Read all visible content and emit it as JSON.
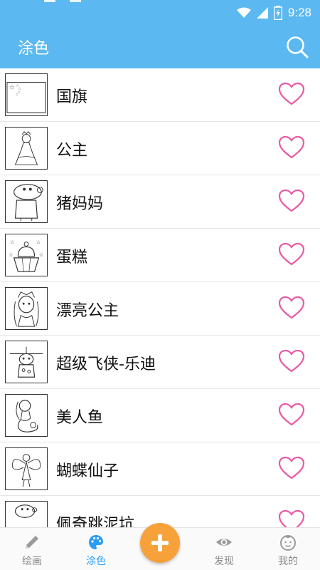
{
  "status": {
    "time": "9:28"
  },
  "header": {
    "title": "涂色"
  },
  "items": [
    {
      "label": "国旗"
    },
    {
      "label": "公主"
    },
    {
      "label": "猪妈妈"
    },
    {
      "label": "蛋糕"
    },
    {
      "label": "漂亮公主"
    },
    {
      "label": "超级飞侠-乐迪"
    },
    {
      "label": "美人鱼"
    },
    {
      "label": "蝴蝶仙子"
    },
    {
      "label": "佩奇跳泥坑"
    }
  ],
  "tabs": [
    {
      "label": "绘画",
      "icon": "pencil-icon"
    },
    {
      "label": "涂色",
      "icon": "palette-icon",
      "active": true
    },
    {
      "label": "",
      "icon": "plus-icon"
    },
    {
      "label": "发现",
      "icon": "eye-icon"
    },
    {
      "label": "我的",
      "icon": "face-icon"
    }
  ],
  "colors": {
    "primary": "#5bb8f0",
    "accent": "#f7a13a",
    "heart": "#e85aa6",
    "active_tab": "#2a9df4"
  }
}
